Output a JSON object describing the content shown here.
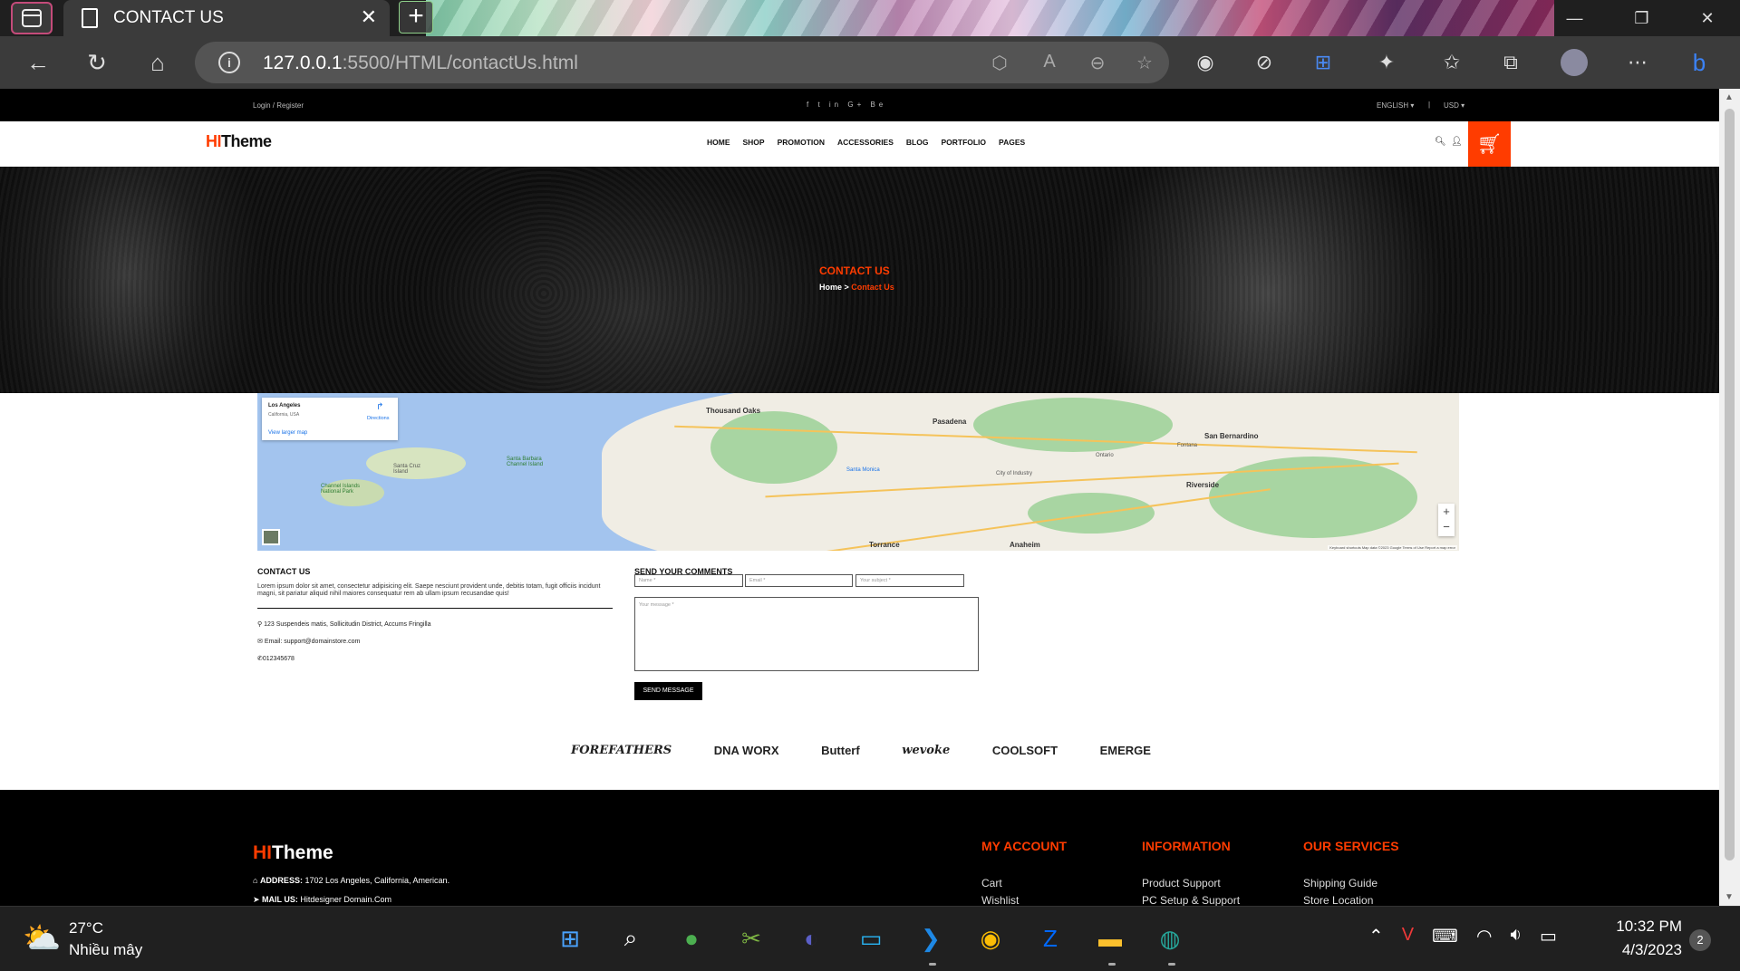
{
  "browser": {
    "tab_title": "CONTACT US",
    "close_glyph": "✕",
    "new_tab_glyph": "+",
    "url_host": "127.0.0.1",
    "url_rest": ":5500/HTML/contactUs.html",
    "accent": "#c44b7a"
  },
  "site": {
    "topbar": {
      "login": "Login / Register",
      "social": "f  t  in  G+  Be",
      "language": "ENGLISH ▾",
      "separator": "|",
      "currency": "USD ▾"
    },
    "logo": {
      "hi": "HI",
      "theme": "Theme"
    },
    "menu": [
      "HOME",
      "SHOP",
      "PROMOTION",
      "ACCESSORIES",
      "BLOG",
      "PORTFOLIO",
      "PAGES"
    ],
    "accent": "#ff3c00",
    "hero": {
      "title": "CONTACT US",
      "bread_home": "Home >",
      "bread_current": "Contact Us"
    },
    "map": {
      "card_title": "Los Angeles",
      "card_sub": "California, USA",
      "card_link": "View larger map",
      "card_dir": "Directions",
      "zoom_in": "+",
      "zoom_out": "−",
      "attribution": "Keyboard shortcuts   Map data ©2023 Google   Terms of Use   Report a map error",
      "labels": {
        "thousand_oaks": "Thousand Oaks",
        "pasadena": "Pasadena",
        "san_bernardino": "San Bernardino",
        "riverside": "Riverside",
        "anaheim": "Anaheim",
        "torrance": "Torrance",
        "santa_monica": "Santa Monica",
        "city_of_industry": "City of Industry",
        "ontario": "Ontario",
        "fontana": "Fontana",
        "channel_islands": "Channel Islands National Park",
        "santa_cruz": "Santa Cruz Island",
        "santa_barbara": "Santa Barbara Channel Island"
      }
    },
    "contact": {
      "title": "CONTACT US",
      "text": "Lorem ipsum dolor sit amet, consectetur adipisicing elit. Saepe nesciunt provident unde, debitis totam, fugit officiis incidunt magni, sit pariatur aliquid nihil maiores consequatur rem ab ullam ipsum recusandae quis!",
      "address": "123 Suspendeis matis, Sollicitudin District, Accums Fringilla",
      "email": "Email: support@domainstore.com",
      "phone": "012345678"
    },
    "form": {
      "title": "SEND YOUR COMMENTS",
      "name_placeholder": "Name *",
      "email_placeholder": "Email *",
      "subject_placeholder": "Your subject *",
      "message_placeholder": "Your message *",
      "send": "SEND MESSAGE"
    },
    "brands": [
      "FOREFATHERS",
      "DNA WORX",
      "Butterf",
      "wevoke",
      "COOLSOFT",
      "EMERGE"
    ],
    "footer": {
      "logo_hi": "HI",
      "logo_theme": "Theme",
      "address_label": "ADDRESS:",
      "address": "1702 Los Angeles, California, American.",
      "mail_label": "MAIL US:",
      "mail": "Hitdesigner Domain.Com",
      "columns": [
        {
          "heading": "MY ACCOUNT",
          "items": [
            "Cart",
            "Wishlist"
          ]
        },
        {
          "heading": "INFORMATION",
          "items": [
            "Product Support",
            "PC Setup & Support"
          ]
        },
        {
          "heading": "OUR SERVICES",
          "items": [
            "Shipping Guide",
            "Store Location"
          ]
        }
      ]
    }
  },
  "taskbar": {
    "temp": "27°C",
    "weather": "Nhiều mây",
    "time": "10:32 PM",
    "date": "4/3/2023",
    "notifications": "2"
  }
}
